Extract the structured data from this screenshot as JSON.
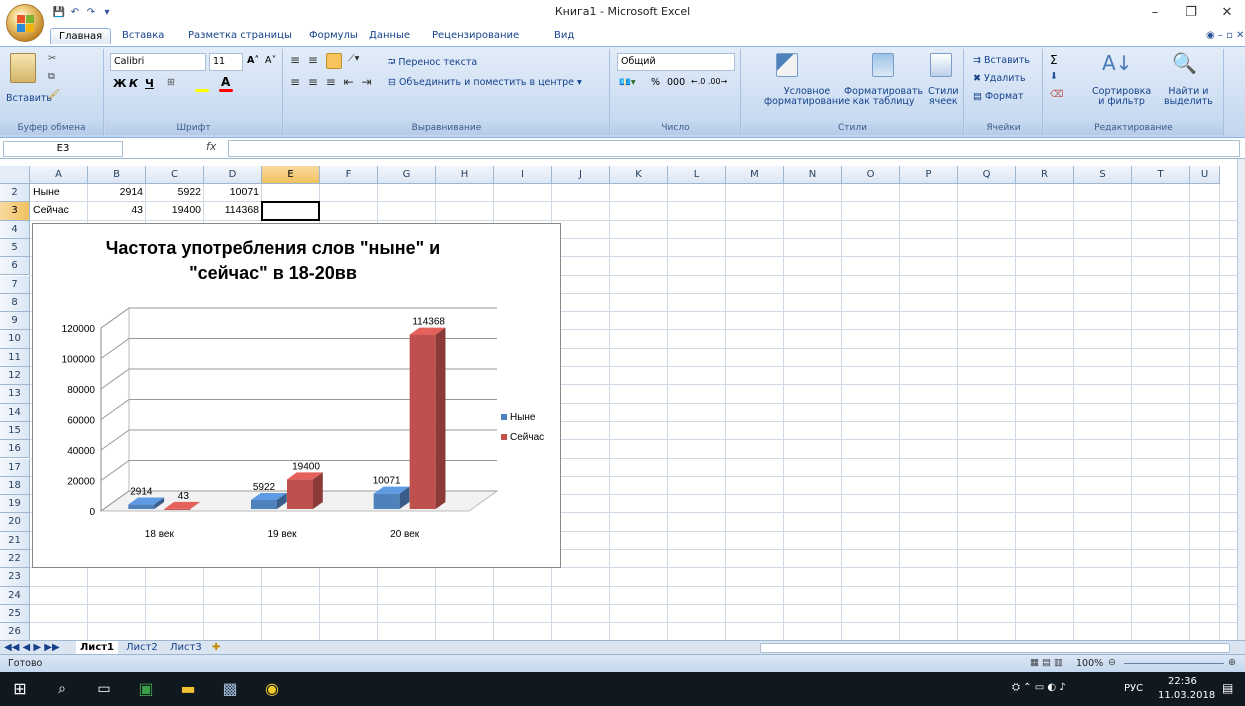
{
  "window": {
    "title": "Книга1 - Microsoft Excel",
    "controls": [
      "–",
      "❐",
      "✕"
    ]
  },
  "qat": [
    "💾",
    "↶",
    "↷",
    "▾"
  ],
  "tabs": [
    "Главная",
    "Вставка",
    "Разметка страницы",
    "Формулы",
    "Данные",
    "Рецензирование",
    "Вид"
  ],
  "ribbon": {
    "clipboard": {
      "label": "Буфер обмена",
      "paste": "Вставить"
    },
    "font": {
      "label": "Шрифт",
      "name": "Calibri",
      "size": "11",
      "bold": "Ж",
      "italic": "К",
      "underline": "Ч"
    },
    "alignment": {
      "label": "Выравнивание",
      "wrap": "Перенос текста",
      "merge": "Объединить и поместить в центре"
    },
    "number": {
      "label": "Число",
      "format": "Общий",
      "percent": "%",
      "thousands": "000"
    },
    "styles": {
      "label": "Стили",
      "cond": [
        "Условное",
        "форматирование"
      ],
      "table": [
        "Форматировать",
        "как таблицу"
      ],
      "cell": [
        "Стили",
        "ячеек"
      ]
    },
    "cells": {
      "label": "Ячейки",
      "insert": "Вставить",
      "delete": "Удалить",
      "format": "Формат"
    },
    "editing": {
      "label": "Редактирование",
      "sort": [
        "Сортировка",
        "и фильтр"
      ],
      "find": [
        "Найти и",
        "выделить"
      ]
    }
  },
  "formula_bar": {
    "name_box": "E3",
    "fx": "fx",
    "value": ""
  },
  "columns": [
    "A",
    "B",
    "C",
    "D",
    "E",
    "F",
    "G",
    "H",
    "I",
    "J",
    "K",
    "L",
    "M",
    "N",
    "O",
    "P",
    "Q",
    "R",
    "S",
    "T",
    "U"
  ],
  "rows": [
    "2",
    "3",
    "4",
    "5",
    "6",
    "7",
    "8",
    "9",
    "10",
    "11",
    "12",
    "13",
    "14",
    "15",
    "16",
    "17",
    "18",
    "19",
    "20",
    "21",
    "22",
    "23",
    "24",
    "25",
    "26"
  ],
  "cells": {
    "A2": "Ныне",
    "B2": "2914",
    "C2": "5922",
    "D2": "10071",
    "A3": "Сейчас",
    "B3": "43",
    "C3": "19400",
    "D3": "114368"
  },
  "chart_data": {
    "type": "bar",
    "title": "Частота употребления слов \"ныне\" и \"сейчас\" в 18-20вв",
    "title_lines": [
      "Частота употребления слов \"ныне\" и",
      "\"сейчас\" в 18-20вв"
    ],
    "categories": [
      "18 век",
      "19 век",
      "20 век"
    ],
    "series": [
      {
        "name": "Ныне",
        "values": [
          2914,
          5922,
          10071
        ],
        "color": "#4f81bd"
      },
      {
        "name": "Сейчас",
        "values": [
          43,
          19400,
          114368
        ],
        "color": "#c0504d"
      }
    ],
    "ylim": [
      0,
      120000
    ],
    "yticks": [
      "0",
      "20000",
      "40000",
      "60000",
      "80000",
      "100000",
      "120000"
    ],
    "grid": true,
    "legend": "right",
    "style": "3d-clustered-column"
  },
  "sheets": [
    "Лист1",
    "Лист2",
    "Лист3"
  ],
  "status": {
    "ready": "Готово",
    "zoom": "100%"
  },
  "taskbar": {
    "time": "22:36",
    "date": "11.03.2018",
    "lang": "РУС"
  }
}
